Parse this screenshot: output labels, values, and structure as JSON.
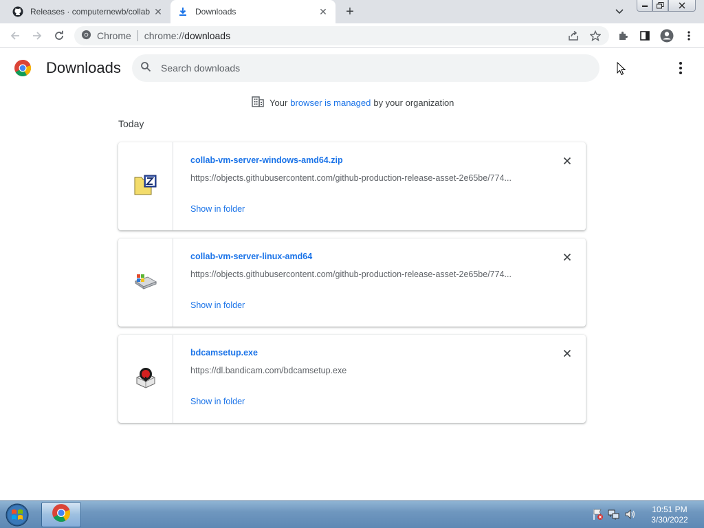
{
  "tabs": [
    {
      "title": "Releases · computernewb/collab",
      "icon": "github-icon"
    },
    {
      "title": "Downloads",
      "icon": "download-icon"
    }
  ],
  "toolbar": {
    "omnibox_label": "Chrome",
    "url_scheme": "chrome://",
    "url_path": "downloads"
  },
  "page": {
    "title": "Downloads",
    "search_placeholder": "Search downloads",
    "managed_prefix": "Your",
    "managed_link": "browser is managed",
    "managed_suffix": "by your organization",
    "date_header": "Today"
  },
  "downloads": [
    {
      "filename": "collab-vm-server-windows-amd64.zip",
      "url": "https://objects.githubusercontent.com/github-production-release-asset-2e65be/774...",
      "action": "Show in folder",
      "icon": "zip-file-icon"
    },
    {
      "filename": "collab-vm-server-linux-amd64",
      "url": "https://objects.githubusercontent.com/github-production-release-asset-2e65be/774...",
      "action": "Show in folder",
      "icon": "generic-file-icon"
    },
    {
      "filename": "bdcamsetup.exe",
      "url": "https://dl.bandicam.com/bdcamsetup.exe",
      "action": "Show in folder",
      "icon": "bandicam-icon"
    }
  ],
  "taskbar": {
    "time": "10:51 PM",
    "date": "3/30/2022"
  },
  "colors": {
    "link": "#1a73e8",
    "tabstrip": "#dee1e6",
    "searchbg": "#f1f3f4"
  }
}
